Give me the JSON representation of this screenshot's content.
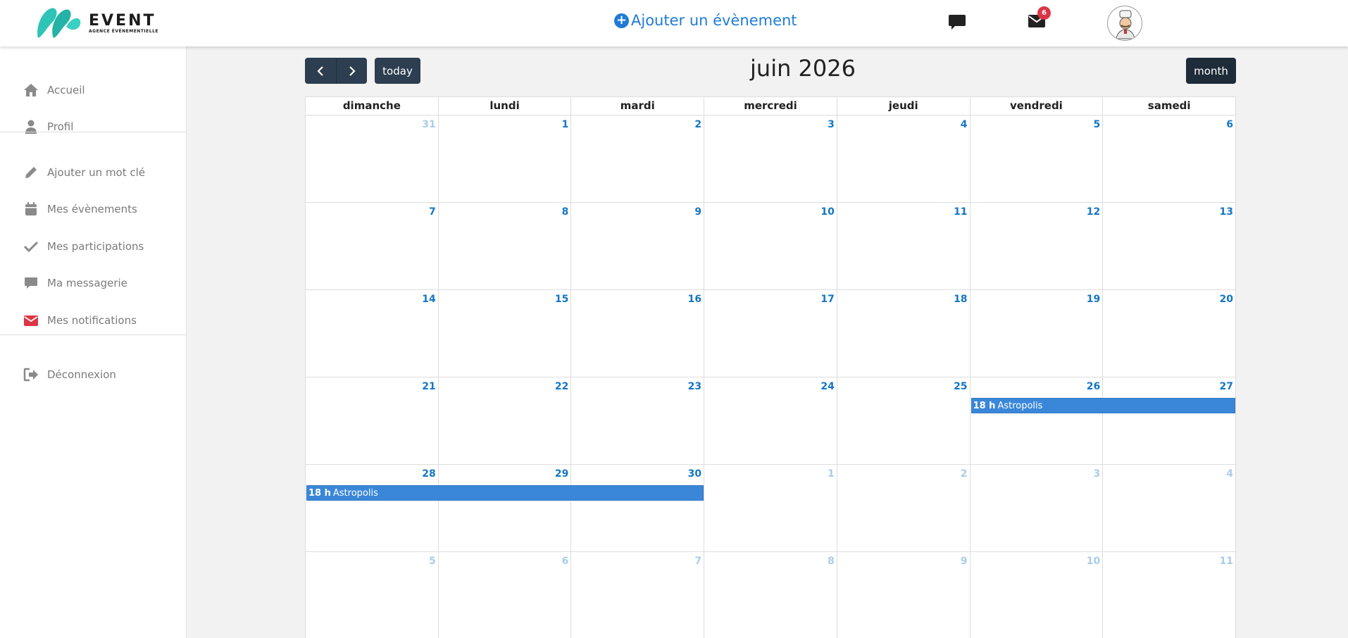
{
  "brand": {
    "name": "EVENT",
    "tagline": "AGENCE ÉVÉNEMENTIELLE",
    "colors": {
      "primary": "#2ec4b6",
      "accent": "#1e7bd6"
    }
  },
  "header": {
    "add_event_label": "Ajouter un évènement",
    "messages_icon": "chat-bubble-icon",
    "notifications_icon": "envelope-icon",
    "notifications_count": "6"
  },
  "sidebar": {
    "items": [
      {
        "label": "Accueil",
        "icon": "home-icon"
      },
      {
        "label": "Profil",
        "icon": "user-icon"
      },
      {
        "label": "Ajouter un mot clé",
        "icon": "pencil-icon"
      },
      {
        "label": "Mes évènements",
        "icon": "calendar-icon"
      },
      {
        "label": "Mes participations",
        "icon": "check-icon"
      },
      {
        "label": "Ma messagerie",
        "icon": "chat-bubble-icon"
      },
      {
        "label": "Mes notifications",
        "icon": "envelope-icon"
      },
      {
        "label": "Déconnexion",
        "icon": "logout-icon"
      }
    ]
  },
  "calendar": {
    "title": "juin 2026",
    "today_label": "today",
    "view_label": "month",
    "weekdays": [
      "dimanche",
      "lundi",
      "mardi",
      "mercredi",
      "jeudi",
      "vendredi",
      "samedi"
    ],
    "weeks": [
      [
        "31",
        "1",
        "2",
        "3",
        "4",
        "5",
        "6"
      ],
      [
        "7",
        "8",
        "9",
        "10",
        "11",
        "12",
        "13"
      ],
      [
        "14",
        "15",
        "16",
        "17",
        "18",
        "19",
        "20"
      ],
      [
        "21",
        "22",
        "23",
        "24",
        "25",
        "26",
        "27"
      ],
      [
        "28",
        "29",
        "30",
        "1",
        "2",
        "3",
        "4"
      ],
      [
        "5",
        "6",
        "7",
        "8",
        "9",
        "10",
        "11"
      ]
    ],
    "events": [
      {
        "time": "18 h",
        "title": "Astropolis",
        "start": "26",
        "end": "27"
      },
      {
        "time": "18 h",
        "title": "Astropolis",
        "start": "28",
        "end": "30"
      }
    ]
  }
}
